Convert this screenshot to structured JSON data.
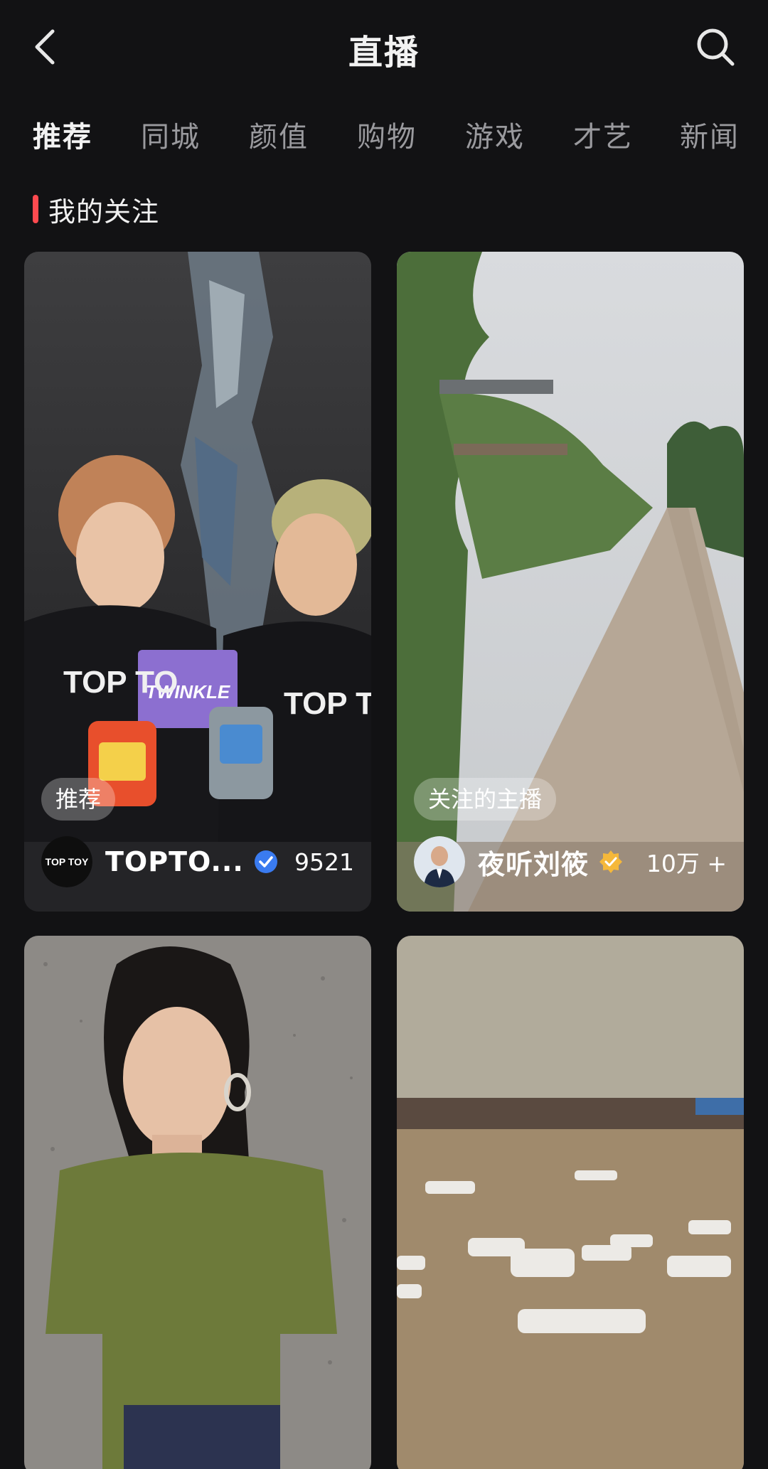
{
  "header": {
    "title": "直播",
    "back_icon": "chevron-left-icon",
    "search_icon": "search-icon"
  },
  "tabs": [
    "推荐",
    "同城",
    "颜值",
    "购物",
    "游戏",
    "才艺",
    "新闻"
  ],
  "active_tab": "推荐",
  "section": {
    "title": "我的关注",
    "accent_color": "#fe4a4f"
  },
  "cards": [
    {
      "tag": "推荐",
      "avatar_text": "TOP TOY",
      "name": "TOPTO...",
      "verified": "blue",
      "viewers": "9521",
      "cover_text": [
        "TOP TO",
        "TWINKLE",
        "TOP TO"
      ]
    },
    {
      "tag": "关注的主播",
      "name": "夜听刘筱",
      "verified": "gold",
      "viewers": "10万 +"
    },
    {
      "tag": "",
      "name": "",
      "viewers": ""
    },
    {
      "tag": "",
      "name": "",
      "viewers": ""
    }
  ],
  "colors": {
    "background": "#121214",
    "verify_blue": "#3a7bf0",
    "verify_gold": "#f5b83a"
  }
}
